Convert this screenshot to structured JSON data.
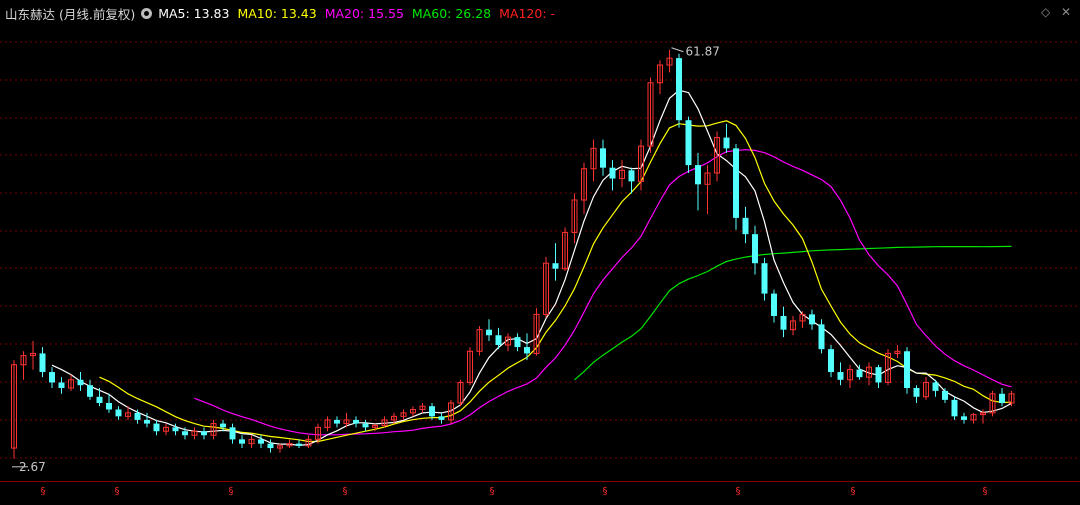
{
  "legend": {
    "title": "山东赫达 (月线.前复权)",
    "ma5": "MA5: 13.83",
    "ma10": "MA10: 13.43",
    "ma20": "MA20: 15.55",
    "ma60": "MA60: 26.28",
    "ma120": "MA120: -"
  },
  "colors": {
    "background": "#000000",
    "up": "#ff3232",
    "down": "#54ffff",
    "ma5": "#ffffff",
    "ma10": "#ffff00",
    "ma20": "#ff00ff",
    "ma60": "#00e600",
    "ma120": "#ff2020",
    "grid": "#7a0000"
  },
  "controls": {
    "diamond": "◇",
    "close": "✕"
  },
  "chart_data": {
    "type": "candlestick",
    "y_scale": "log",
    "ylim": [
      2.45,
      72
    ],
    "high_label": "61.87",
    "low_label": "2.67",
    "ohlc": [
      [
        2.9,
        5.7,
        2.67,
        5.5
      ],
      [
        5.5,
        6.1,
        4.9,
        5.9
      ],
      [
        5.9,
        6.6,
        5.3,
        6.0
      ],
      [
        6.0,
        6.3,
        5.0,
        5.2
      ],
      [
        5.2,
        5.4,
        4.6,
        4.8
      ],
      [
        4.8,
        5.0,
        4.4,
        4.6
      ],
      [
        4.6,
        5.1,
        4.5,
        4.9
      ],
      [
        4.9,
        5.2,
        4.5,
        4.7
      ],
      [
        4.7,
        4.9,
        4.2,
        4.3
      ],
      [
        4.3,
        4.6,
        4.0,
        4.1
      ],
      [
        4.1,
        4.4,
        3.8,
        3.9
      ],
      [
        3.9,
        4.0,
        3.6,
        3.7
      ],
      [
        3.7,
        4.0,
        3.6,
        3.8
      ],
      [
        3.8,
        3.9,
        3.5,
        3.6
      ],
      [
        3.6,
        3.8,
        3.4,
        3.5
      ],
      [
        3.5,
        3.6,
        3.2,
        3.3
      ],
      [
        3.3,
        3.5,
        3.2,
        3.4
      ],
      [
        3.4,
        3.5,
        3.2,
        3.3
      ],
      [
        3.3,
        3.4,
        3.1,
        3.2
      ],
      [
        3.2,
        3.4,
        3.1,
        3.3
      ],
      [
        3.3,
        3.4,
        3.1,
        3.2
      ],
      [
        3.2,
        3.6,
        3.1,
        3.5
      ],
      [
        3.5,
        3.6,
        3.3,
        3.4
      ],
      [
        3.4,
        3.5,
        3.0,
        3.1
      ],
      [
        3.1,
        3.2,
        2.9,
        3.0
      ],
      [
        3.0,
        3.2,
        2.9,
        3.1
      ],
      [
        3.1,
        3.2,
        2.9,
        3.0
      ],
      [
        3.0,
        3.1,
        2.8,
        2.9
      ],
      [
        2.9,
        3.0,
        2.8,
        2.95
      ],
      [
        2.95,
        3.1,
        2.9,
        3.0
      ],
      [
        3.0,
        3.1,
        2.9,
        2.95
      ],
      [
        2.95,
        3.2,
        2.9,
        3.1
      ],
      [
        3.1,
        3.5,
        3.0,
        3.4
      ],
      [
        3.4,
        3.7,
        3.3,
        3.6
      ],
      [
        3.6,
        3.7,
        3.4,
        3.5
      ],
      [
        3.5,
        3.8,
        3.4,
        3.6
      ],
      [
        3.6,
        3.7,
        3.4,
        3.5
      ],
      [
        3.5,
        3.6,
        3.3,
        3.4
      ],
      [
        3.4,
        3.5,
        3.3,
        3.45
      ],
      [
        3.45,
        3.7,
        3.4,
        3.6
      ],
      [
        3.6,
        3.8,
        3.5,
        3.7
      ],
      [
        3.7,
        3.9,
        3.6,
        3.8
      ],
      [
        3.8,
        4.0,
        3.7,
        3.9
      ],
      [
        3.9,
        4.1,
        3.8,
        4.0
      ],
      [
        4.0,
        4.1,
        3.6,
        3.7
      ],
      [
        3.7,
        3.8,
        3.5,
        3.6
      ],
      [
        3.6,
        4.2,
        3.5,
        4.1
      ],
      [
        4.1,
        4.9,
        4.0,
        4.8
      ],
      [
        4.8,
        6.3,
        4.7,
        6.1
      ],
      [
        6.1,
        7.4,
        5.9,
        7.2
      ],
      [
        7.2,
        7.8,
        6.6,
        6.9
      ],
      [
        6.9,
        7.3,
        6.2,
        6.4
      ],
      [
        6.4,
        7.0,
        6.1,
        6.8
      ],
      [
        6.8,
        7.0,
        6.1,
        6.3
      ],
      [
        6.3,
        7.0,
        5.7,
        6.0
      ],
      [
        6.0,
        8.5,
        5.9,
        8.1
      ],
      [
        8.1,
        12.6,
        7.9,
        12.0
      ],
      [
        12.0,
        14.0,
        10.5,
        11.5
      ],
      [
        11.5,
        15.8,
        11.3,
        15.2
      ],
      [
        15.2,
        20.5,
        14.0,
        19.5
      ],
      [
        19.5,
        26.0,
        17.5,
        24.8
      ],
      [
        24.8,
        31.0,
        22.5,
        29.0
      ],
      [
        29.0,
        31.0,
        23.5,
        25.0
      ],
      [
        25.0,
        26.5,
        21.0,
        23.0
      ],
      [
        23.0,
        26.5,
        21.5,
        24.5
      ],
      [
        24.5,
        25.0,
        20.5,
        22.5
      ],
      [
        22.5,
        31.0,
        21.0,
        29.5
      ],
      [
        29.5,
        50.0,
        28.0,
        48.0
      ],
      [
        48.0,
        57.0,
        44.0,
        55.0
      ],
      [
        55.0,
        61.87,
        52.0,
        58.0
      ],
      [
        58.0,
        60.0,
        34.0,
        36.0
      ],
      [
        36.0,
        37.0,
        24.0,
        25.5
      ],
      [
        25.5,
        28.0,
        18.0,
        22.0
      ],
      [
        22.0,
        25.5,
        17.5,
        24.0
      ],
      [
        24.0,
        33.0,
        22.5,
        31.5
      ],
      [
        31.5,
        35.0,
        28.0,
        29.0
      ],
      [
        29.0,
        30.0,
        15.5,
        17.0
      ],
      [
        17.0,
        18.5,
        14.0,
        15.0
      ],
      [
        15.0,
        16.0,
        11.0,
        12.0
      ],
      [
        12.0,
        12.5,
        9.0,
        9.5
      ],
      [
        9.5,
        9.8,
        7.6,
        8.0
      ],
      [
        8.0,
        8.6,
        6.8,
        7.2
      ],
      [
        7.2,
        8.0,
        6.9,
        7.7
      ],
      [
        7.7,
        8.3,
        7.3,
        8.1
      ],
      [
        8.1,
        8.4,
        7.2,
        7.5
      ],
      [
        7.5,
        7.8,
        6.0,
        6.2
      ],
      [
        6.2,
        6.4,
        5.0,
        5.2
      ],
      [
        5.2,
        5.6,
        4.7,
        4.9
      ],
      [
        4.9,
        5.5,
        4.6,
        5.3
      ],
      [
        5.3,
        5.5,
        4.9,
        5.0
      ],
      [
        5.0,
        5.6,
        4.7,
        5.4
      ],
      [
        5.4,
        5.5,
        4.6,
        4.8
      ],
      [
        4.8,
        6.2,
        4.7,
        6.0
      ],
      [
        6.0,
        6.4,
        5.8,
        6.1
      ],
      [
        6.1,
        6.3,
        4.4,
        4.6
      ],
      [
        4.6,
        4.7,
        4.1,
        4.3
      ],
      [
        4.3,
        5.0,
        4.2,
        4.8
      ],
      [
        4.8,
        4.9,
        4.3,
        4.5
      ],
      [
        4.5,
        4.6,
        4.1,
        4.2
      ],
      [
        4.2,
        4.3,
        3.6,
        3.7
      ],
      [
        3.7,
        3.8,
        3.5,
        3.6
      ],
      [
        3.6,
        3.8,
        3.5,
        3.75
      ],
      [
        3.75,
        3.9,
        3.5,
        3.8
      ],
      [
        3.8,
        4.5,
        3.7,
        4.4
      ],
      [
        4.4,
        4.6,
        4.0,
        4.1
      ],
      [
        4.1,
        4.5,
        4.0,
        4.4
      ]
    ]
  }
}
